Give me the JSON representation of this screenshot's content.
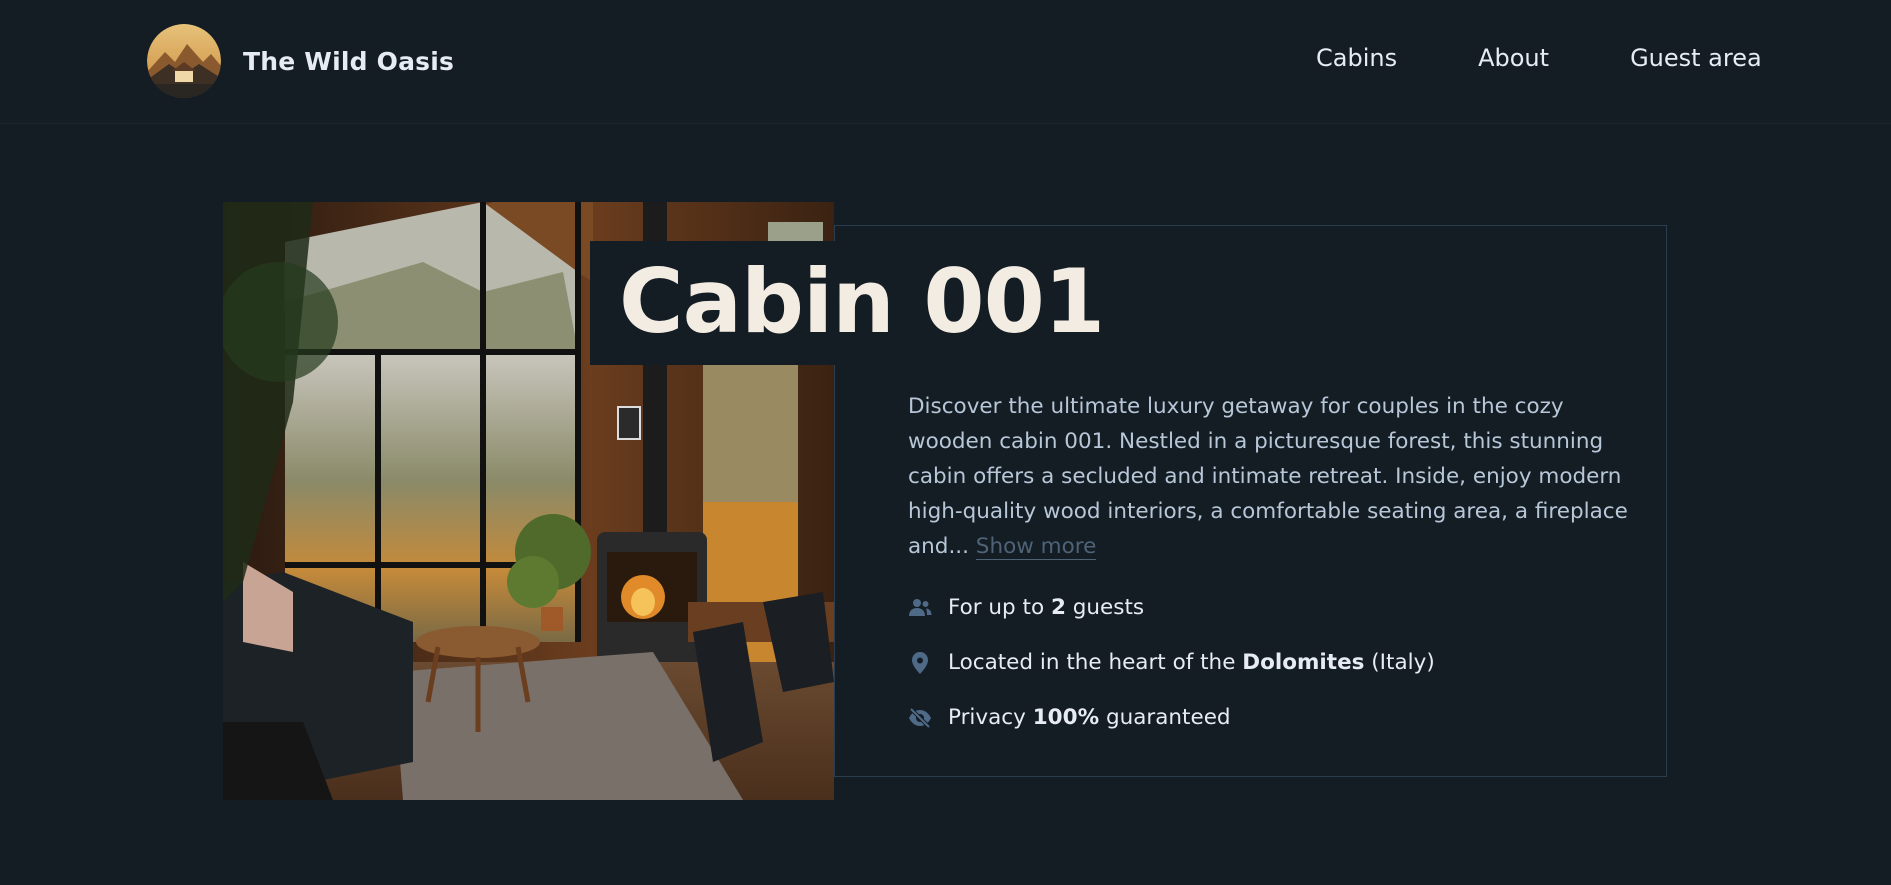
{
  "header": {
    "brand": "The Wild Oasis",
    "nav": [
      {
        "label": "Cabins"
      },
      {
        "label": "About"
      },
      {
        "label": "Guest area"
      }
    ]
  },
  "cabin": {
    "title": "Cabin 001",
    "description": "Discover the ultimate luxury getaway for couples in the cozy wooden cabin 001. Nestled in a picturesque forest, this stunning cabin offers a secluded and intimate retreat. Inside, enjoy modern high-quality wood interiors, a comfortable seating area, a fireplace and...",
    "show_more": "Show more",
    "features": {
      "guests": {
        "pre": "For up to",
        "value": "2",
        "post": "guests"
      },
      "location": {
        "pre": "Located in the heart of the",
        "value": "Dolomites",
        "post": "(Italy)"
      },
      "privacy": {
        "pre": "Privacy",
        "value": "100%",
        "post": "guaranteed"
      }
    }
  },
  "icons": {
    "guests": "users-icon",
    "location": "map-pin-icon",
    "privacy": "eye-slash-icon"
  },
  "colors": {
    "background": "#141c24",
    "accent_icon": "#4e6a87",
    "title": "#f3ece3",
    "muted_link": "#4e6376"
  }
}
